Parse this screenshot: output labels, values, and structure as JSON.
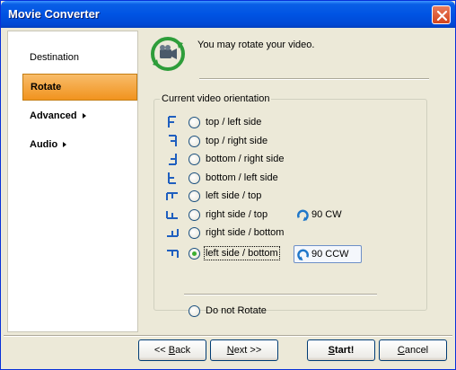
{
  "window": {
    "title": "Movie Converter"
  },
  "sidebar": {
    "items": [
      {
        "label": "Destination"
      },
      {
        "label": "Rotate"
      },
      {
        "label": "Advanced"
      },
      {
        "label": "Audio"
      }
    ]
  },
  "header": {
    "text": "You may rotate your video."
  },
  "group": {
    "label": "Current video orientation",
    "options": [
      {
        "label": "top / left side",
        "selected": false
      },
      {
        "label": "top / right side",
        "selected": false
      },
      {
        "label": "bottom / right side",
        "selected": false
      },
      {
        "label": "bottom / left side",
        "selected": false
      },
      {
        "label": "left side / top",
        "selected": false
      },
      {
        "label": "right side / top",
        "selected": false
      },
      {
        "label": "right side / bottom",
        "selected": false
      },
      {
        "label": "left side / bottom",
        "selected": true
      },
      {
        "label": "Do not Rotate",
        "selected": false
      }
    ],
    "rotate_cw_label": "90 CW",
    "rotate_ccw_label": "90 CCW"
  },
  "buttons": {
    "back": {
      "prefix": "<< ",
      "mnemonic": "B",
      "rest": "ack"
    },
    "next": {
      "mnemonic": "N",
      "rest": "ext >>"
    },
    "start": {
      "mnemonic": "S",
      "rest": "tart!"
    },
    "cancel": {
      "mnemonic": "C",
      "rest": "ancel"
    }
  },
  "colors": {
    "titlebar": "#0054e3",
    "sidebar_active": "#f1931e",
    "radio_check": "#3cae2f",
    "rotate_icon": "#1f77c9"
  }
}
